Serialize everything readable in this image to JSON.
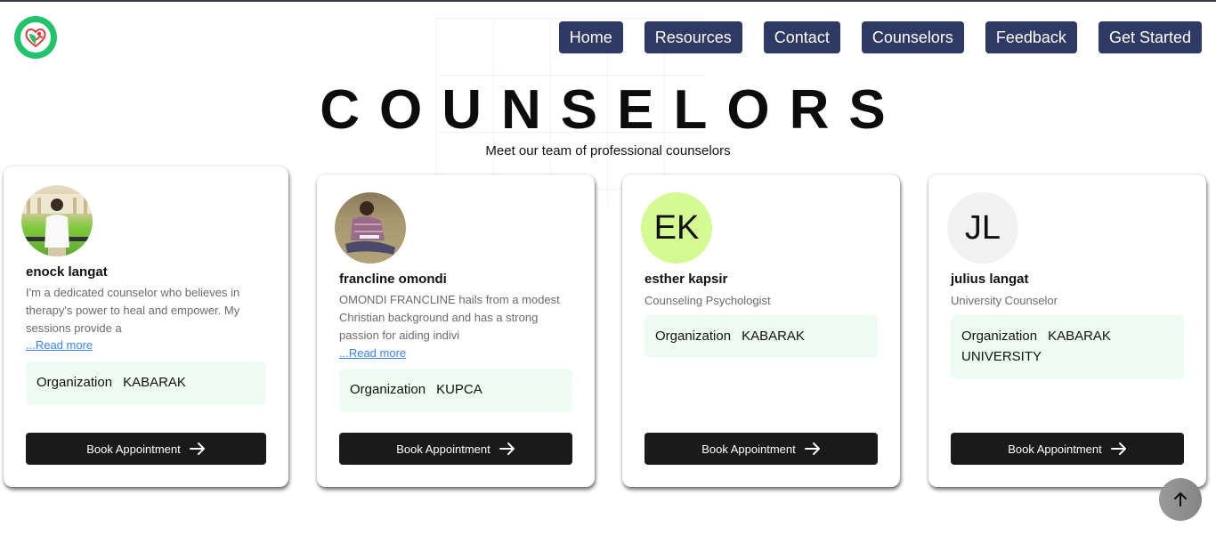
{
  "header": {
    "logo_icon": "heart-care-logo",
    "nav": [
      {
        "label": "Home"
      },
      {
        "label": "Resources"
      },
      {
        "label": "Contact"
      },
      {
        "label": "Counselors"
      },
      {
        "label": "Feedback"
      },
      {
        "label": "Get Started"
      }
    ]
  },
  "page": {
    "title": "COUNSELORS",
    "subtitle": "Meet our team of professional counselors"
  },
  "counselors": [
    {
      "name": "enock langat",
      "avatar": "photo",
      "bio": "I'm a dedicated counselor who believes in therapy's power to heal and empower. My sessions provide a",
      "read_more": "...Read more",
      "org_label": "Organization",
      "org_value": "KABARAK",
      "book_label": "Book Appointment"
    },
    {
      "name": "francline omondi",
      "avatar": "photo",
      "bio": "OMONDI FRANCLINE hails from a modest Christian background and has a strong passion for aiding indivi",
      "read_more": "...Read more",
      "org_label": "Organization",
      "org_value": "KUPCA",
      "book_label": "Book Appointment"
    },
    {
      "name": "esther kapsir",
      "avatar": "initials",
      "initials": "EK",
      "avatar_color": "#d4fa94",
      "title": "Counseling Psychologist",
      "org_label": "Organization",
      "org_value": "KABARAK",
      "book_label": "Book Appointment"
    },
    {
      "name": "julius langat",
      "avatar": "initials",
      "initials": "JL",
      "avatar_color": "#f1f1f1",
      "title": "University Counselor",
      "org_label": "Organization",
      "org_value": "KABARAK UNIVERSITY",
      "book_label": "Book Appointment"
    }
  ],
  "colors": {
    "nav_bg": "#2e3a64",
    "book_bg": "#1a1a1b",
    "org_bg": "#eefbf3",
    "link": "#3b82f6",
    "logo_green": "#22c36b"
  },
  "scroll_top_icon": "arrow-up-icon"
}
